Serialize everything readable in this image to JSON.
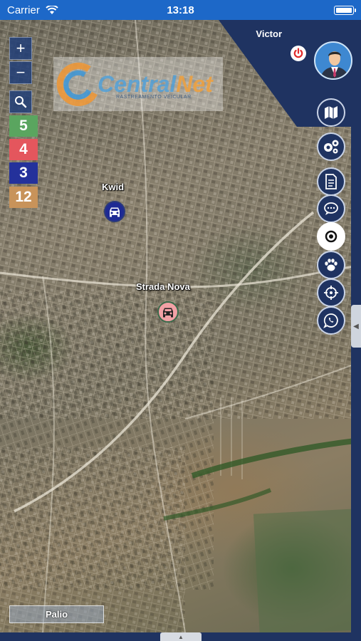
{
  "status_bar": {
    "carrier": "Carrier",
    "time": "13:18"
  },
  "header": {
    "user_name": "Victor"
  },
  "logo": {
    "name_part1": "Central",
    "name_part2": "Net",
    "tagline": "RASTREAMENTO VEICULAR"
  },
  "map_controls": {
    "zoom_in": "+",
    "zoom_out": "−"
  },
  "vehicle_counts": [
    {
      "value": "5",
      "color": "#5aa55f"
    },
    {
      "value": "4",
      "color": "#e4565d"
    },
    {
      "value": "3",
      "color": "#24319b"
    },
    {
      "value": "12",
      "color": "#c8935a"
    }
  ],
  "side_buttons": [
    {
      "icon": "map-icon",
      "active": false
    },
    {
      "icon": "settings-icon",
      "active": false
    },
    {
      "icon": "document-icon",
      "active": false
    },
    {
      "icon": "chat-icon",
      "active": false
    },
    {
      "icon": "target-icon",
      "active": true
    },
    {
      "icon": "paw-icon",
      "active": false
    },
    {
      "icon": "crosshair-icon",
      "active": false
    },
    {
      "icon": "whatsapp-icon",
      "active": false
    }
  ],
  "vehicles": [
    {
      "label": "Kwid",
      "color": "#1e2a94",
      "icon": "car-icon"
    },
    {
      "label": "Strada Nova",
      "color": "#f2a1a6",
      "icon": "car-icon"
    },
    {
      "label": "Palio"
    }
  ],
  "colors": {
    "accent": "#1f3361",
    "status_bar": "#1d68c8",
    "power": "#e22b2b"
  }
}
